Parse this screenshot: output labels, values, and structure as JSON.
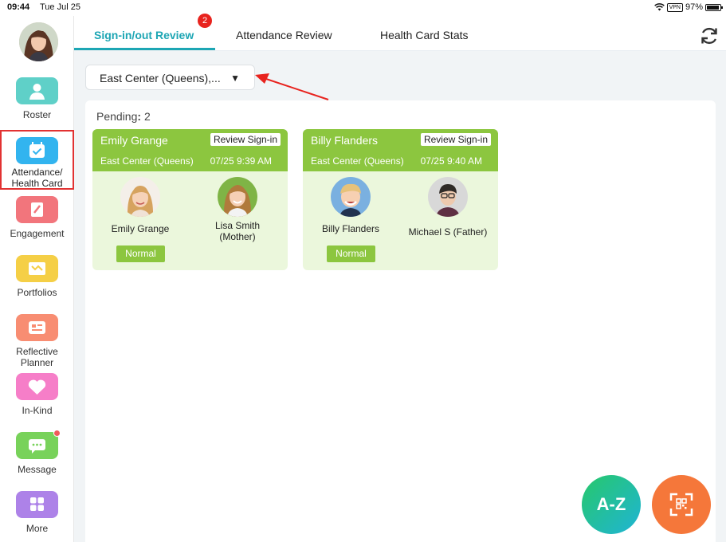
{
  "status_bar": {
    "time": "09:44",
    "date": "Tue Jul 25",
    "vpn": "VPN",
    "battery": "97%"
  },
  "sidebar": {
    "items": [
      {
        "label": "Roster",
        "color": "#5fd0c8"
      },
      {
        "label": "Attendance/ Health Card",
        "label_line1": "Attendance/",
        "label_line2": "Health Card",
        "color": "#32b4ef"
      },
      {
        "label": "Engagement",
        "color": "#f2757c"
      },
      {
        "label": "Portfolios",
        "color": "#f5cf46"
      },
      {
        "label": "Reflective Planner",
        "label_line1": "Reflective",
        "label_line2": "Planner",
        "color": "#f88d72"
      },
      {
        "label": "In-Kind",
        "color": "#f67ec8"
      },
      {
        "label": "Message",
        "color": "#78d25a"
      },
      {
        "label": "More",
        "color": "#ad82e8"
      }
    ]
  },
  "tabs": {
    "items": [
      "Sign-in/out Review",
      "Attendance Review",
      "Health Card Stats"
    ],
    "badge": "2"
  },
  "center_selector": {
    "value": "East Center (Queens),...",
    "caret": "▼"
  },
  "pending": {
    "label": "Pending",
    "separator": ":",
    "count": "2"
  },
  "cards": [
    {
      "name": "Emily Grange",
      "review_label": "Review Sign-in",
      "center": "East Center (Queens)",
      "time": "07/25 9:39 AM",
      "child_name": "Emily Grange",
      "status": "Normal",
      "guardian_line1": "Lisa Smith",
      "guardian_line2": "(Mother)"
    },
    {
      "name": "Billy Flanders",
      "review_label": "Review Sign-in",
      "center": "East Center (Queens)",
      "time": "07/25 9:40 AM",
      "child_name": "Billy Flanders",
      "status": "Normal",
      "guardian_line1": "Michael S (Father)",
      "guardian_line2": ""
    }
  ],
  "fab": {
    "sort_label": "A-Z"
  },
  "colors": {
    "accent": "#1da6b4",
    "card_green": "#8cc63f",
    "card_bg": "#ebf7dc",
    "badge_red": "#e8231e",
    "highlight_red": "#e23232"
  },
  "icons": [
    "avatar",
    "roster-icon",
    "attendance-icon",
    "engagement-icon",
    "portfolios-icon",
    "planner-icon",
    "heart-icon",
    "message-icon",
    "grid-icon",
    "refresh-icon",
    "qr-scan-icon",
    "annotation-arrow"
  ]
}
